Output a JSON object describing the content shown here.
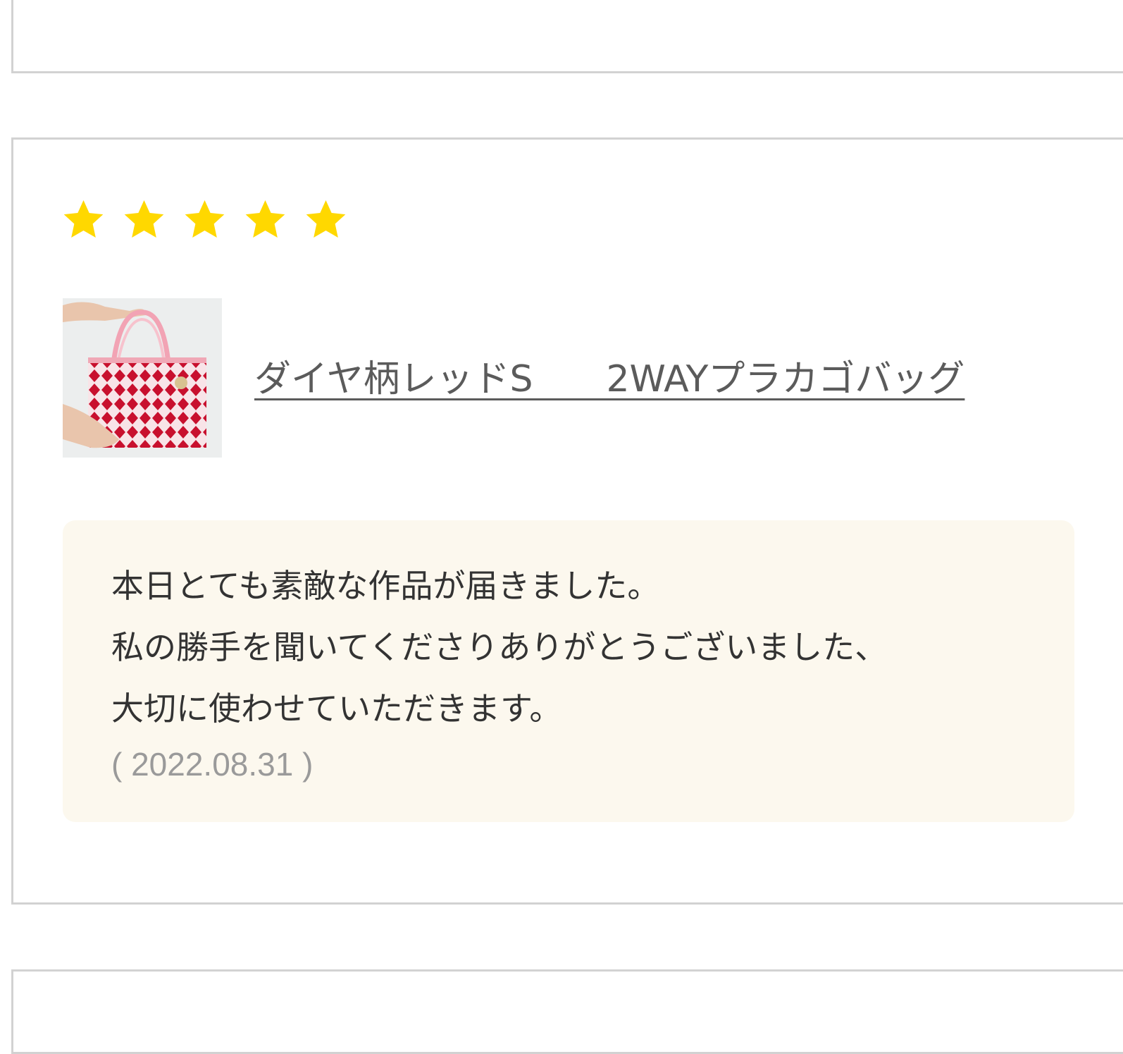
{
  "review": {
    "rating": 5,
    "rating_max": 5,
    "star_color": "#ffd800",
    "product": {
      "image_icon": "product-thumbnail",
      "name": "ダイヤ柄レッドS　　2WAYプラカゴバッグ"
    },
    "text_lines": [
      "本日とても素敵な作品が届きました。",
      "私の勝手を聞いてくださりありがとうございました、",
      "大切に使わせていただきます。"
    ],
    "date": "( 2022.08.31 )",
    "box_color": "#fcf8ee"
  },
  "colors": {
    "border": "#d2d2d2",
    "link": "#5b5b5b",
    "date": "#9a9a9a"
  }
}
